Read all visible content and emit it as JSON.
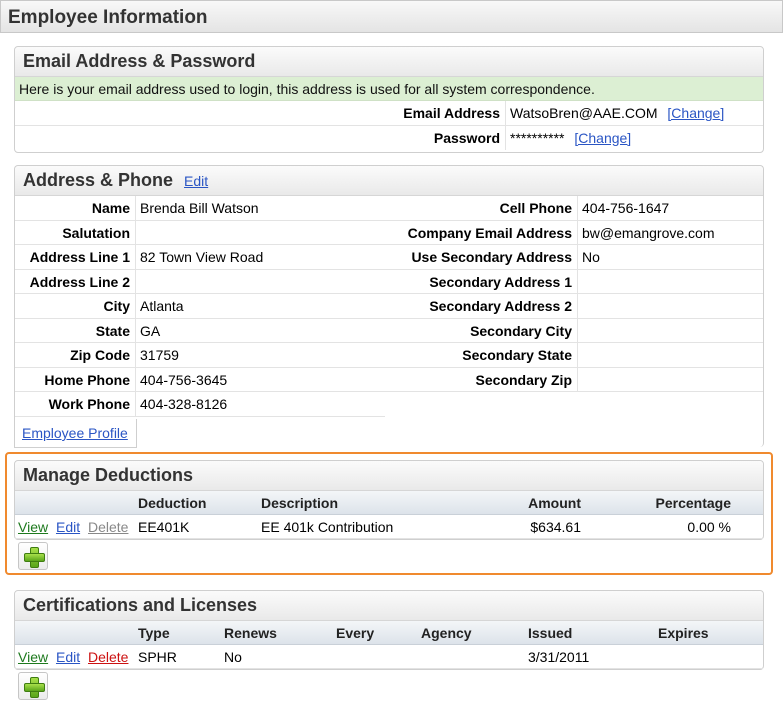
{
  "page": {
    "title": "Employee Information"
  },
  "email_section": {
    "title": "Email Address & Password",
    "notice": "Here is your email address used to login, this address is used for all system correspondence.",
    "email_label": "Email Address",
    "email_value": "WatsoBren@AAE.COM",
    "password_label": "Password",
    "password_value": "**********",
    "change_label": "[Change]"
  },
  "address_section": {
    "title": "Address & Phone",
    "edit_label": "Edit",
    "left": [
      {
        "label": "Name",
        "value": "Brenda Bill Watson"
      },
      {
        "label": "Salutation",
        "value": ""
      },
      {
        "label": "Address Line 1",
        "value": "82 Town View Road"
      },
      {
        "label": "Address Line 2",
        "value": ""
      },
      {
        "label": "City",
        "value": "Atlanta"
      },
      {
        "label": "State",
        "value": "GA"
      },
      {
        "label": "Zip Code",
        "value": "31759"
      },
      {
        "label": "Home Phone",
        "value": "404-756-3645"
      },
      {
        "label": "Work Phone",
        "value": "404-328-8126"
      }
    ],
    "right": [
      {
        "label": "Cell Phone",
        "value": "404-756-1647"
      },
      {
        "label": "Company Email Address",
        "value": "bw@emangrove.com"
      },
      {
        "label": "Use Secondary Address",
        "value": "No"
      },
      {
        "label": "Secondary Address 1",
        "value": ""
      },
      {
        "label": "Secondary Address 2",
        "value": ""
      },
      {
        "label": "Secondary City",
        "value": ""
      },
      {
        "label": "Secondary State",
        "value": ""
      },
      {
        "label": "Secondary Zip",
        "value": ""
      }
    ],
    "profile_link": "Employee Profile"
  },
  "deductions_section": {
    "title": "Manage Deductions",
    "columns": [
      "Deduction",
      "Description",
      "Amount",
      "Percentage"
    ],
    "rows": [
      {
        "view": "View",
        "edit": "Edit",
        "delete": "Delete",
        "deduction": "EE401K",
        "description": "EE 401k Contribution",
        "amount": "$634.61",
        "percentage": "0.00 %"
      }
    ]
  },
  "certifications_section": {
    "title": "Certifications and Licenses",
    "columns": [
      "Type",
      "Renews",
      "Every",
      "Agency",
      "Issued",
      "Expires"
    ],
    "rows": [
      {
        "view": "View",
        "edit": "Edit",
        "delete": "Delete",
        "type": "SPHR",
        "renews": "No",
        "every": "",
        "agency": "",
        "issued": "3/31/2011",
        "expires": ""
      }
    ]
  },
  "colors": {
    "link": "#2a55c4",
    "view_link": "#1e7a1e",
    "delete_link_active": "#cc1111",
    "delete_link_disabled": "#888888",
    "notice_bg": "#dcefd3",
    "highlight_border": "#f08a2e"
  }
}
